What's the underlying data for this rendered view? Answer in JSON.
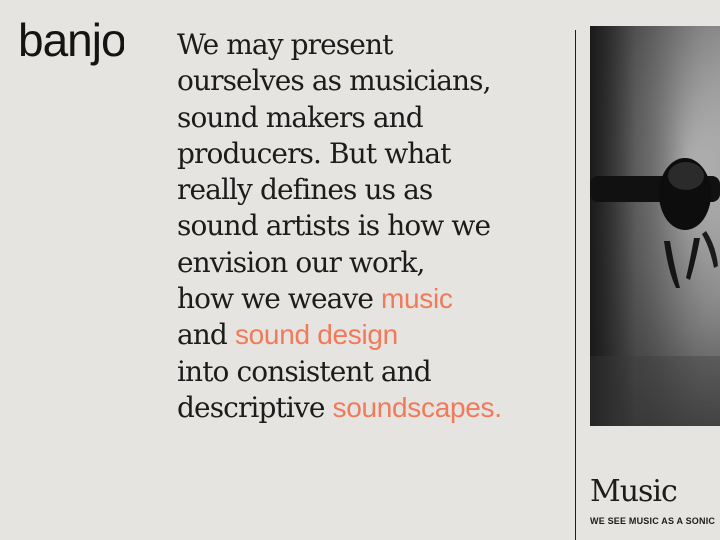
{
  "brand": {
    "logo_text": "banjo"
  },
  "intro": {
    "lines": [
      "We may present",
      "ourselves as musicians,",
      "sound makers and",
      "producers. But what",
      "really defines us as",
      "sound artists is how we",
      "envision our work,"
    ],
    "line_weave_prefix": "how we weave ",
    "highlight_music": "music",
    "line_and_prefix": "and ",
    "highlight_sound_design": "sound design",
    "line_into": "into consistent and",
    "line_descriptive_prefix": "descriptive ",
    "highlight_soundscapes": "soundscapes."
  },
  "card": {
    "title": "Music",
    "subtitle": "WE SEE MUSIC AS A SONIC"
  },
  "colors": {
    "background": "#e5e4e0",
    "text": "#1c1c1c",
    "accent": "#f07a5a"
  }
}
